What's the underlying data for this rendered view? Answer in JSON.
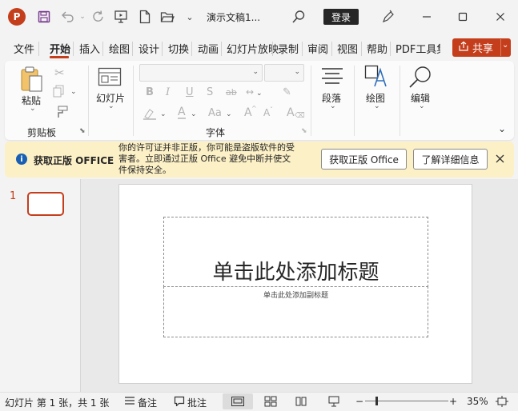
{
  "titlebar": {
    "app_logo": "P",
    "doc_title": "演示文稿1...",
    "login_label": "登录",
    "icons": [
      "save-icon",
      "undo-icon",
      "redo-icon",
      "present-icon",
      "new-file-icon",
      "open-folder-icon",
      "customize-qat-icon",
      "search-icon",
      "pen-icon",
      "minimize-icon",
      "maximize-icon",
      "close-icon"
    ]
  },
  "tabs": [
    "文件",
    "开始",
    "插入",
    "绘图",
    "设计",
    "切换",
    "动画",
    "幻灯片放映",
    "录制",
    "审阅",
    "视图",
    "帮助",
    "PDF工具集"
  ],
  "active_tab": "开始",
  "share_label": "共享",
  "ribbon": {
    "paste_label": "粘贴",
    "clipboard_group": "剪贴板",
    "slides_label": "幻灯片",
    "font_group": "字体",
    "paragraph_label": "段落",
    "drawing_label": "绘图",
    "editing_label": "编辑",
    "bold": "B",
    "italic": "I",
    "underline": "U",
    "strike": "S",
    "strike2": "ab",
    "font_color": "A",
    "case": "Aa",
    "grow": "A",
    "shrink": "A",
    "clear": "A"
  },
  "warning": {
    "title": "获取正版 OFFICE",
    "message": [
      "你的许可证并非正版，你可能是盗版软件的受",
      "害者。立即通过正版 Office 避免中断并使文",
      "件保持安全。"
    ],
    "get_genuine_label": "获取正版 Office",
    "learn_more_label": "了解详细信息"
  },
  "thumbnails": [
    {
      "number": "1"
    }
  ],
  "slide": {
    "title_placeholder": "单击此处添加标题",
    "subtitle_placeholder": "单击此处添加副标题"
  },
  "statusbar": {
    "slide_info": "幻灯片 第 1 张，共 1 张",
    "notes_label": "备注",
    "comments_label": "批注",
    "zoom_minus": "−",
    "zoom_plus": "+",
    "zoom_level": "35%",
    "zoom_fraction": 0.35
  },
  "colors": {
    "accent": "#c43e1c",
    "warning_bg": "#fcf0c6",
    "dark_button": "#262626"
  }
}
